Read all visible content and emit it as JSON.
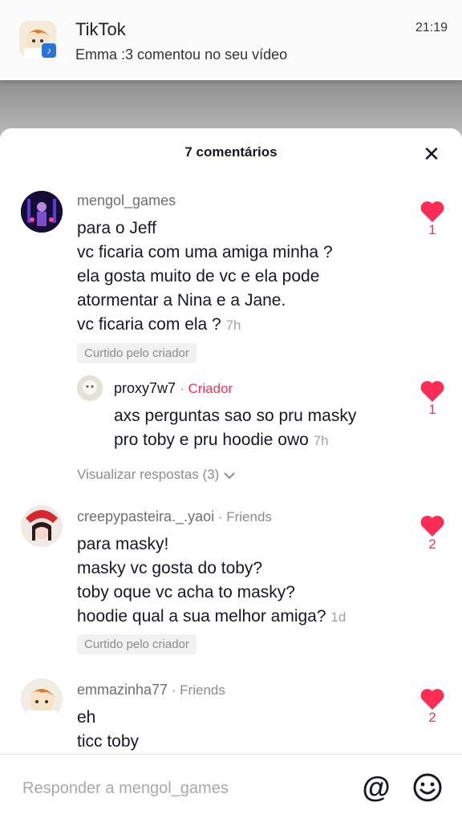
{
  "notification": {
    "app": "TikTok",
    "message": "Emma :3 comentou no seu vídeo",
    "time": "21:19"
  },
  "sheet": {
    "title": "7 comentários",
    "close_icon": "close-icon"
  },
  "comments": [
    {
      "username": "mengol_games",
      "lines": [
        "para o Jeff",
        "vc ficaria com uma amiga minha ?",
        "ela gosta muito de vc e ela pode",
        "atormentar a Nina e a Jane."
      ],
      "last_line": "vc ficaria com ela ?",
      "time": "7h",
      "liked_badge": "Curtido pelo criador",
      "likes": "1"
    },
    {
      "username": "proxy7w7",
      "tag": "Criador",
      "line1": "axs perguntas sao so pru masky",
      "last_line": "pro toby e pru hoodie owo",
      "time": "7h",
      "likes": "1"
    },
    {
      "username": "creepypasteira._.yaoi",
      "tag": "Friends",
      "lines": [
        "para masky!",
        "masky vc gosta do toby?",
        "toby oque vc acha to masky?"
      ],
      "last_line": "hoodie qual a sua melhor amiga?",
      "time": "1d",
      "liked_badge": "Curtido pelo criador",
      "likes": "2"
    },
    {
      "username": "emmazinha77",
      "tag": "Friends",
      "lines": [
        "eh",
        "ticc toby"
      ],
      "likes": "2"
    }
  ],
  "view_replies": "Visualizar respostas (3)",
  "reply": {
    "placeholder": "Responder a mengol_games",
    "mention_icon": "at-icon",
    "emoji_icon": "emoji-icon"
  },
  "colors": {
    "accent": "#fe2c55",
    "heart": "#fe2c55",
    "text": "#161823",
    "muted": "#8a8b91"
  }
}
